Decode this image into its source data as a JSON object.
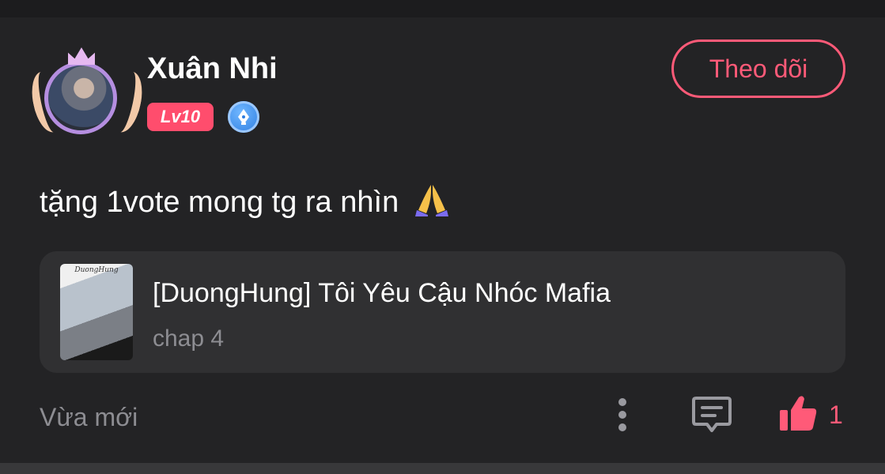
{
  "user": {
    "name": "Xuân Nhi",
    "level": "Lv10",
    "follow_label": "Theo dõi"
  },
  "comment": {
    "text": "tặng 1vote mong tg ra nhìn",
    "emoji": "🙏"
  },
  "story": {
    "title": "[DuongHung] Tôi Yêu Cậu Nhóc Mafia",
    "chapter": "chap 4",
    "cover_text": "DuongHung"
  },
  "footer": {
    "timestamp": "Vừa mới",
    "like_count": "1"
  },
  "icons": {
    "more": "more-vertical-icon",
    "reply": "comment-icon",
    "like": "thumbs-up-icon",
    "writer": "pen-nib-icon"
  },
  "colors": {
    "accent": "#ff5a78",
    "level_badge": "#ff4d6d",
    "background": "#232325",
    "card": "#303032",
    "muted_text": "#8d8d92"
  }
}
